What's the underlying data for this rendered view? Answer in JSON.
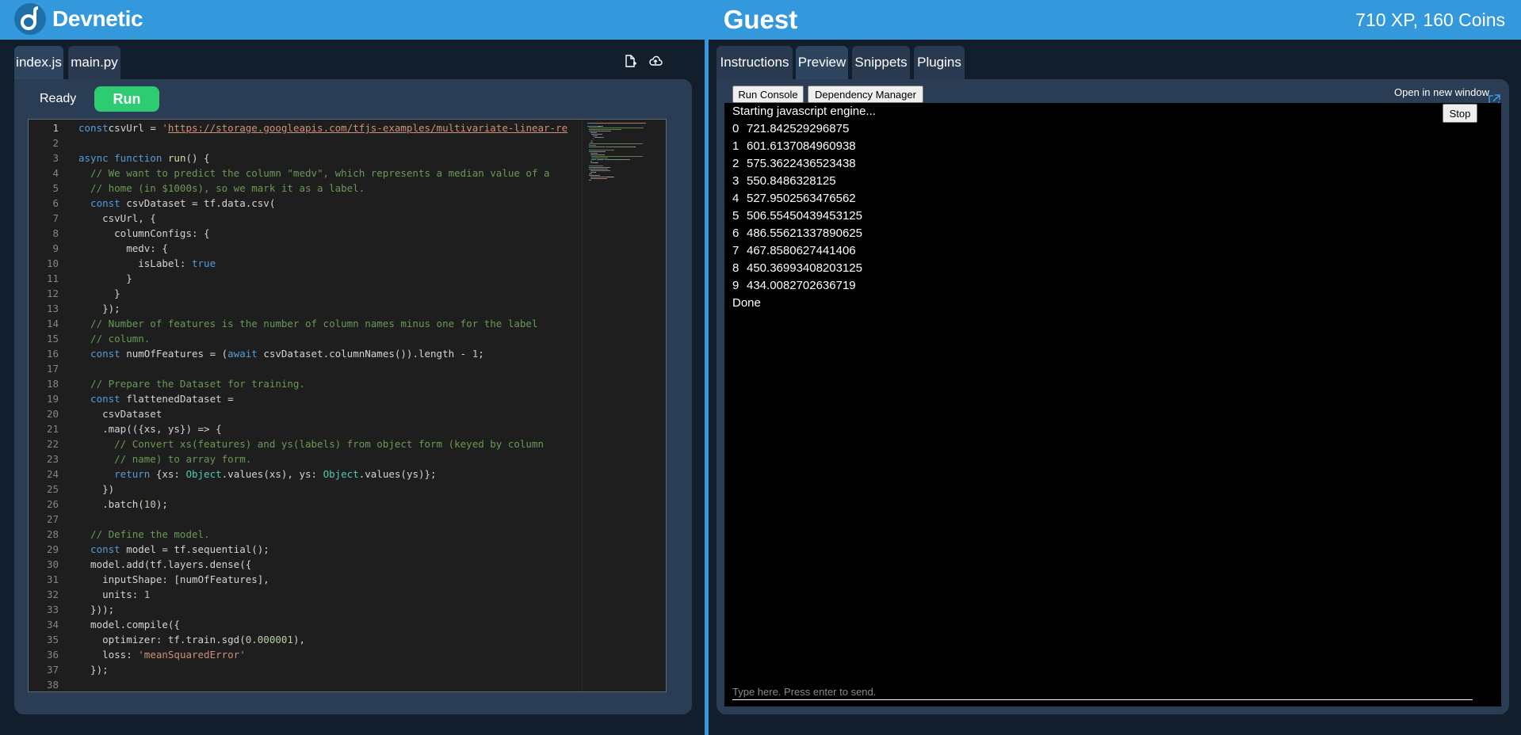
{
  "header": {
    "brand": "Devnetic",
    "user": "Guest",
    "stats": "710 XP, 160 Coins"
  },
  "editor": {
    "tabs": [
      "index.js",
      "main.py"
    ],
    "active_tab": "index.js",
    "status": "Ready",
    "run_label": "Run",
    "current_line": 1
  },
  "code_lines": [
    [
      [
        "kw",
        "const"
      ],
      [
        "",
        "csvUrl = "
      ],
      [
        "st",
        "'"
      ],
      [
        "url",
        "https://storage.googleapis.com/tfjs-examples/multivariate-linear-re"
      ]
    ],
    [],
    [
      [
        "kw",
        "async function "
      ],
      [
        "fn",
        "run"
      ],
      [
        "",
        "() {"
      ]
    ],
    [
      [
        "cm",
        "  // We want to predict the column \"medv\", which represents a median value of a"
      ]
    ],
    [
      [
        "cm",
        "  // home (in $1000s), so we mark it as a label."
      ]
    ],
    [
      [
        "kw",
        "  const "
      ],
      [
        "",
        "csvDataset = tf.data.csv("
      ]
    ],
    [
      [
        "",
        "    csvUrl, {"
      ]
    ],
    [
      [
        "",
        "      columnConfigs: {"
      ]
    ],
    [
      [
        "",
        "        medv: {"
      ]
    ],
    [
      [
        "",
        "          isLabel: "
      ],
      [
        "kw",
        "true"
      ]
    ],
    [
      [
        "",
        "        }"
      ]
    ],
    [
      [
        "",
        "      }"
      ]
    ],
    [
      [
        "",
        "    });"
      ]
    ],
    [
      [
        "cm",
        "  // Number of features is the number of column names minus one for the label"
      ]
    ],
    [
      [
        "cm",
        "  // column."
      ]
    ],
    [
      [
        "kw",
        "  const "
      ],
      [
        "",
        "numOfFeatures = ("
      ],
      [
        "kw",
        "await "
      ],
      [
        "",
        "csvDataset.columnNames()).length - "
      ],
      [
        "nm",
        "1"
      ],
      [
        "",
        ";"
      ]
    ],
    [],
    [
      [
        "cm",
        "  // Prepare the Dataset for training."
      ]
    ],
    [
      [
        "kw",
        "  const "
      ],
      [
        "",
        "flattenedDataset ="
      ]
    ],
    [
      [
        "",
        "    csvDataset"
      ]
    ],
    [
      [
        "",
        "    .map(({xs, ys}) => {"
      ]
    ],
    [
      [
        "cm",
        "      // Convert xs(features) and ys(labels) from object form (keyed by column"
      ]
    ],
    [
      [
        "cm",
        "      // name) to array form."
      ]
    ],
    [
      [
        "kw",
        "      return "
      ],
      [
        "",
        "{xs: "
      ],
      [
        "ty",
        "Object"
      ],
      [
        "",
        ".values(xs), ys: "
      ],
      [
        "ty",
        "Object"
      ],
      [
        "",
        ".values(ys)};"
      ]
    ],
    [
      [
        "",
        "    })"
      ]
    ],
    [
      [
        "",
        "    .batch("
      ],
      [
        "nm",
        "10"
      ],
      [
        "",
        ");"
      ]
    ],
    [],
    [
      [
        "cm",
        "  // Define the model."
      ]
    ],
    [
      [
        "kw",
        "  const "
      ],
      [
        "",
        "model = tf.sequential();"
      ]
    ],
    [
      [
        "",
        "  model.add(tf.layers.dense({"
      ]
    ],
    [
      [
        "",
        "    inputShape: [numOfFeatures],"
      ]
    ],
    [
      [
        "",
        "    units: "
      ],
      [
        "nm",
        "1"
      ]
    ],
    [
      [
        "",
        "  }));"
      ]
    ],
    [
      [
        "",
        "  model.compile({"
      ]
    ],
    [
      [
        "",
        "    optimizer: tf.train.sgd("
      ],
      [
        "nm",
        "0.000001"
      ],
      [
        "",
        "),"
      ]
    ],
    [
      [
        "",
        "    loss: "
      ],
      [
        "st",
        "'meanSquaredError'"
      ]
    ],
    [
      [
        "",
        "  });"
      ]
    ],
    []
  ],
  "preview": {
    "tabs": [
      "Instructions",
      "Preview",
      "Snippets",
      "Plugins"
    ],
    "active_tab": "Preview",
    "run_console_label": "Run Console",
    "dependency_label": "Dependency Manager",
    "open_new_window": "Open in new window",
    "stop_label": "Stop",
    "start_message": "Starting javascript engine...",
    "output": [
      {
        "i": "0",
        "v": "721.842529296875"
      },
      {
        "i": "1",
        "v": "601.6137084960938"
      },
      {
        "i": "2",
        "v": "575.3622436523438"
      },
      {
        "i": "3",
        "v": "550.8486328125"
      },
      {
        "i": "4",
        "v": "527.9502563476562"
      },
      {
        "i": "5",
        "v": "506.55450439453125"
      },
      {
        "i": "6",
        "v": "486.55621337890625"
      },
      {
        "i": "7",
        "v": "467.8580627441406"
      },
      {
        "i": "8",
        "v": "450.36993408203125"
      },
      {
        "i": "9",
        "v": "434.0082702636719"
      }
    ],
    "done_message": "Done",
    "input_placeholder": "Type here. Press enter to send."
  },
  "colors": {
    "accent": "#3499dc",
    "run": "#2ecc71",
    "background": "#131e2d"
  }
}
